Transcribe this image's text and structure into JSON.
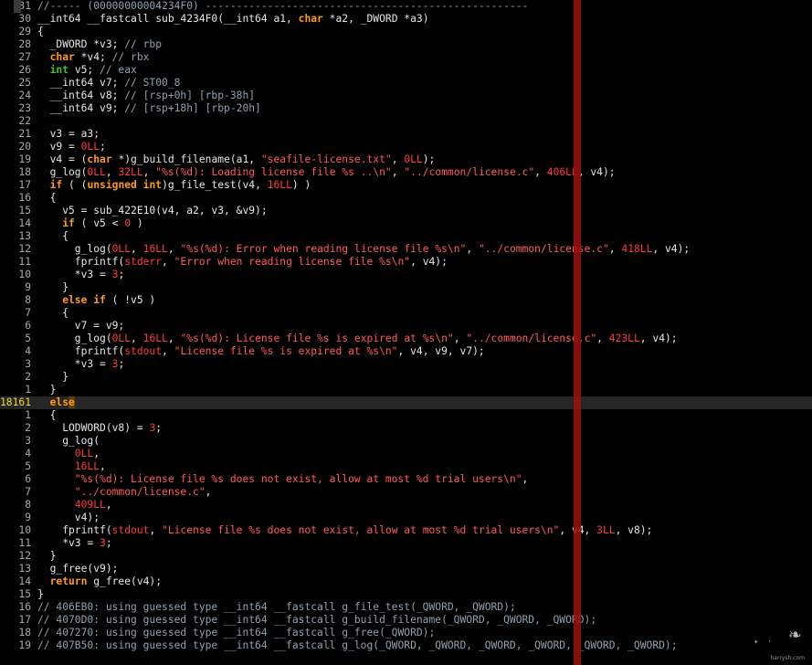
{
  "colors": {
    "background": "#000000",
    "keyword": "#ff9a1f",
    "type": "#39c432",
    "number": "#ff3b3b",
    "string": "#ff5b5b",
    "comment": "#8fa0ad",
    "margin_guide": "#a01010",
    "current_line_number": "#f2d63c"
  },
  "editor": {
    "current_line": "18161",
    "lines": [
      {
        "no": "31",
        "tokens": [
          [
            "cm",
            "//----- (00000000004234F0) ----------------------------------------------------"
          ]
        ]
      },
      {
        "no": "30",
        "tokens": [
          [
            "pl",
            "__int64 __fastcall sub_4234F0(__int64 a1, "
          ],
          [
            "kw",
            "char"
          ],
          [
            "pl",
            " *a2, _DWORD *a3)"
          ]
        ]
      },
      {
        "no": "29",
        "tokens": [
          [
            "pl",
            "{"
          ]
        ]
      },
      {
        "no": "28",
        "tokens": [
          [
            "pl",
            "  _DWORD *v3; "
          ],
          [
            "cm",
            "// rbp"
          ]
        ]
      },
      {
        "no": "27",
        "tokens": [
          [
            "kw",
            "  char"
          ],
          [
            "pl",
            " *v4; "
          ],
          [
            "cm",
            "// rbx"
          ]
        ]
      },
      {
        "no": "26",
        "tokens": [
          [
            "ty",
            "  int"
          ],
          [
            "pl",
            " v5; "
          ],
          [
            "cm",
            "// eax"
          ]
        ]
      },
      {
        "no": "25",
        "tokens": [
          [
            "pl",
            "  __int64 v7; "
          ],
          [
            "cm",
            "// ST00_8"
          ]
        ]
      },
      {
        "no": "24",
        "tokens": [
          [
            "pl",
            "  __int64 v8; "
          ],
          [
            "cm",
            "// [rsp+0h] [rbp-38h]"
          ]
        ]
      },
      {
        "no": "23",
        "tokens": [
          [
            "pl",
            "  __int64 v9; "
          ],
          [
            "cm",
            "// [rsp+18h] [rbp-20h]"
          ]
        ]
      },
      {
        "no": "22",
        "tokens": []
      },
      {
        "no": "21",
        "tokens": [
          [
            "pl",
            "  v3 = a3;"
          ]
        ]
      },
      {
        "no": "20",
        "tokens": [
          [
            "pl",
            "  v9 = "
          ],
          [
            "num",
            "0LL"
          ],
          [
            "pl",
            ";"
          ]
        ]
      },
      {
        "no": "19",
        "tokens": [
          [
            "pl",
            "  v4 = ("
          ],
          [
            "kw",
            "char"
          ],
          [
            "pl",
            " *)g_build_filename(a1, "
          ],
          [
            "str",
            "\"seafile-license.txt\""
          ],
          [
            "pl",
            ", "
          ],
          [
            "num",
            "0LL"
          ],
          [
            "pl",
            ");"
          ]
        ]
      },
      {
        "no": "18",
        "tokens": [
          [
            "pl",
            "  g_log("
          ],
          [
            "num",
            "0LL"
          ],
          [
            "pl",
            ", "
          ],
          [
            "num",
            "32LL"
          ],
          [
            "pl",
            ", "
          ],
          [
            "str",
            "\"%s(%d): Loading license file %s ..\\n\""
          ],
          [
            "pl",
            ", "
          ],
          [
            "str",
            "\"../common/license.c\""
          ],
          [
            "pl",
            ", "
          ],
          [
            "num",
            "406LL"
          ],
          [
            "pl",
            ", v4);"
          ]
        ]
      },
      {
        "no": "17",
        "tokens": [
          [
            "kw",
            "  if"
          ],
          [
            "pl",
            " ( ("
          ],
          [
            "kw",
            "unsigned int"
          ],
          [
            "pl",
            ")g_file_test(v4, "
          ],
          [
            "num",
            "16LL"
          ],
          [
            "pl",
            ") )"
          ]
        ]
      },
      {
        "no": "16",
        "tokens": [
          [
            "pl",
            "  {"
          ]
        ]
      },
      {
        "no": "15",
        "tokens": [
          [
            "pl",
            "    v5 = sub_422E10(v4, a2, v3, &v9);"
          ]
        ]
      },
      {
        "no": "14",
        "tokens": [
          [
            "kw",
            "    if"
          ],
          [
            "pl",
            " ( v5 < "
          ],
          [
            "num",
            "0"
          ],
          [
            "pl",
            " )"
          ]
        ]
      },
      {
        "no": "13",
        "tokens": [
          [
            "pl",
            "    {"
          ]
        ]
      },
      {
        "no": "12",
        "tokens": [
          [
            "pl",
            "      g_log("
          ],
          [
            "num",
            "0LL"
          ],
          [
            "pl",
            ", "
          ],
          [
            "num",
            "16LL"
          ],
          [
            "pl",
            ", "
          ],
          [
            "str",
            "\"%s(%d): Error when reading license file %s\\n\""
          ],
          [
            "pl",
            ", "
          ],
          [
            "str",
            "\"../common/license.c\""
          ],
          [
            "pl",
            ", "
          ],
          [
            "num",
            "418LL"
          ],
          [
            "pl",
            ", v4);"
          ]
        ]
      },
      {
        "no": "11",
        "tokens": [
          [
            "pl",
            "      fprintf("
          ],
          [
            "num",
            "stderr"
          ],
          [
            "pl",
            ", "
          ],
          [
            "str",
            "\"Error when reading license file %s\\n\""
          ],
          [
            "pl",
            ", v4);"
          ]
        ]
      },
      {
        "no": "10",
        "tokens": [
          [
            "pl",
            "      *v3 = "
          ],
          [
            "num",
            "3"
          ],
          [
            "pl",
            ";"
          ]
        ]
      },
      {
        "no": "9",
        "tokens": [
          [
            "pl",
            "    }"
          ]
        ]
      },
      {
        "no": "8",
        "tokens": [
          [
            "kw",
            "    else if"
          ],
          [
            "pl",
            " ( !v5 )"
          ]
        ]
      },
      {
        "no": "7",
        "tokens": [
          [
            "pl",
            "    {"
          ]
        ]
      },
      {
        "no": "6",
        "tokens": [
          [
            "pl",
            "      v7 = v9;"
          ]
        ]
      },
      {
        "no": "5",
        "tokens": [
          [
            "pl",
            "      g_log("
          ],
          [
            "num",
            "0LL"
          ],
          [
            "pl",
            ", "
          ],
          [
            "num",
            "16LL"
          ],
          [
            "pl",
            ", "
          ],
          [
            "str",
            "\"%s(%d): License file %s is expired at %s\\n\""
          ],
          [
            "pl",
            ", "
          ],
          [
            "str",
            "\"../common/license.c\""
          ],
          [
            "pl",
            ", "
          ],
          [
            "num",
            "423LL"
          ],
          [
            "pl",
            ", v4);"
          ]
        ]
      },
      {
        "no": "4",
        "tokens": [
          [
            "pl",
            "      fprintf("
          ],
          [
            "num",
            "stdout"
          ],
          [
            "pl",
            ", "
          ],
          [
            "str",
            "\"License file %s is expired at %s\\n\""
          ],
          [
            "pl",
            ", v4, v9, v7);"
          ]
        ]
      },
      {
        "no": "3",
        "tokens": [
          [
            "pl",
            "      *v3 = "
          ],
          [
            "num",
            "3"
          ],
          [
            "pl",
            ";"
          ]
        ]
      },
      {
        "no": "2",
        "tokens": [
          [
            "pl",
            "    }"
          ]
        ]
      },
      {
        "no": "1",
        "tokens": [
          [
            "pl",
            "  }"
          ]
        ]
      },
      {
        "no": "18161",
        "current": true,
        "tokens": [
          [
            "kw",
            "  else"
          ]
        ]
      },
      {
        "no": "1",
        "tokens": [
          [
            "pl",
            "  {"
          ]
        ]
      },
      {
        "no": "2",
        "tokens": [
          [
            "pl",
            "    LODWORD(v8) = "
          ],
          [
            "num",
            "3"
          ],
          [
            "pl",
            ";"
          ]
        ]
      },
      {
        "no": "3",
        "tokens": [
          [
            "pl",
            "    g_log("
          ]
        ]
      },
      {
        "no": "4",
        "tokens": [
          [
            "num",
            "      0LL"
          ],
          [
            "pl",
            ","
          ]
        ]
      },
      {
        "no": "5",
        "tokens": [
          [
            "num",
            "      16LL"
          ],
          [
            "pl",
            ","
          ]
        ]
      },
      {
        "no": "6",
        "tokens": [
          [
            "str",
            "      \"%s(%d): License file %s does not exist, allow at most %d trial users\\n\""
          ],
          [
            "pl",
            ","
          ]
        ]
      },
      {
        "no": "7",
        "tokens": [
          [
            "str",
            "      \"../common/license.c\""
          ],
          [
            "pl",
            ","
          ]
        ]
      },
      {
        "no": "8",
        "tokens": [
          [
            "num",
            "      409LL"
          ],
          [
            "pl",
            ","
          ]
        ]
      },
      {
        "no": "9",
        "tokens": [
          [
            "pl",
            "      v4);"
          ]
        ]
      },
      {
        "no": "10",
        "tokens": [
          [
            "pl",
            "    fprintf("
          ],
          [
            "num",
            "stdout"
          ],
          [
            "pl",
            ", "
          ],
          [
            "str",
            "\"License file %s does not exist, allow at most %d trial users\\n\""
          ],
          [
            "pl",
            ", v4, "
          ],
          [
            "num",
            "3LL"
          ],
          [
            "pl",
            ", v8);"
          ]
        ]
      },
      {
        "no": "11",
        "tokens": [
          [
            "pl",
            "    *v3 = "
          ],
          [
            "num",
            "3"
          ],
          [
            "pl",
            ";"
          ]
        ]
      },
      {
        "no": "12",
        "tokens": [
          [
            "pl",
            "  }"
          ]
        ]
      },
      {
        "no": "13",
        "tokens": [
          [
            "pl",
            "  g_free(v9);"
          ]
        ]
      },
      {
        "no": "14",
        "tokens": [
          [
            "kw",
            "  return"
          ],
          [
            "pl",
            " g_free(v4);"
          ]
        ]
      },
      {
        "no": "15",
        "tokens": [
          [
            "pl",
            "}"
          ]
        ]
      },
      {
        "no": "16",
        "tokens": [
          [
            "cm",
            "// 406EB0: using guessed type __int64 __fastcall g_file_test(_QWORD, _QWORD);"
          ]
        ]
      },
      {
        "no": "17",
        "tokens": [
          [
            "cm",
            "// 4070D0: using guessed type __int64 __fastcall g_build_filename(_QWORD, _QWORD, _QWORD);"
          ]
        ]
      },
      {
        "no": "18",
        "tokens": [
          [
            "cm",
            "// 407270: using guessed type __int64 __fastcall g_free(_QWORD);"
          ]
        ]
      },
      {
        "no": "19",
        "tokens": [
          [
            "cm",
            "// 407B50: using guessed type __int64 __fastcall g_log(_QWORD, _QWORD, _QWORD, _QWORD, _QWORD, _QWORD);"
          ]
        ]
      }
    ]
  },
  "watermark": {
    "glyph": "❧",
    "site": "harrysh.com"
  }
}
